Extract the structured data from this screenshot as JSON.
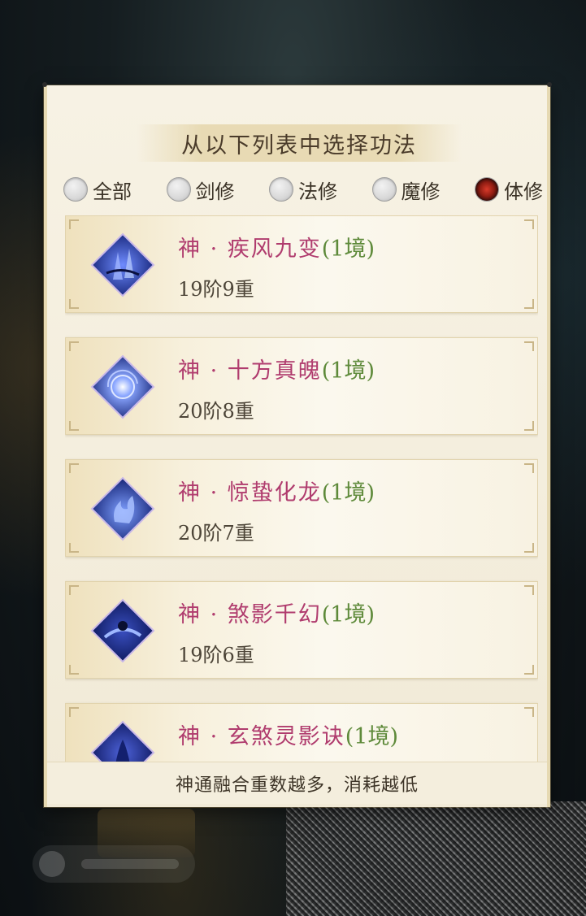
{
  "dialog": {
    "title": "从以下列表中选择功法",
    "footer_note": "神通融合重数越多，消耗越低"
  },
  "filters": [
    {
      "label": "全部",
      "selected": false
    },
    {
      "label": "剑修",
      "selected": false
    },
    {
      "label": "法修",
      "selected": false
    },
    {
      "label": "魔修",
      "selected": false
    },
    {
      "label": "体修",
      "selected": true
    }
  ],
  "skills": [
    {
      "name": "神 · 疾风九变",
      "realm": "(1境)",
      "level": "19阶9重",
      "icon": "wind-pillars-icon"
    },
    {
      "name": "神 · 十方真魄",
      "realm": "(1境)",
      "level": "20阶8重",
      "icon": "swirling-orb-icon"
    },
    {
      "name": "神 · 惊蛰化龙",
      "realm": "(1境)",
      "level": "20阶7重",
      "icon": "azure-flame-icon"
    },
    {
      "name": "神 · 煞影千幻",
      "realm": "(1境)",
      "level": "19阶6重",
      "icon": "shadow-vortex-icon"
    },
    {
      "name": "神 · 玄煞灵影诀",
      "realm": "(1境)",
      "level": "",
      "icon": "dark-spirit-icon"
    }
  ],
  "colors": {
    "skill_name": "#b03c6e",
    "realm": "#5e8a3a",
    "selected_radio": "#8e1c12"
  }
}
